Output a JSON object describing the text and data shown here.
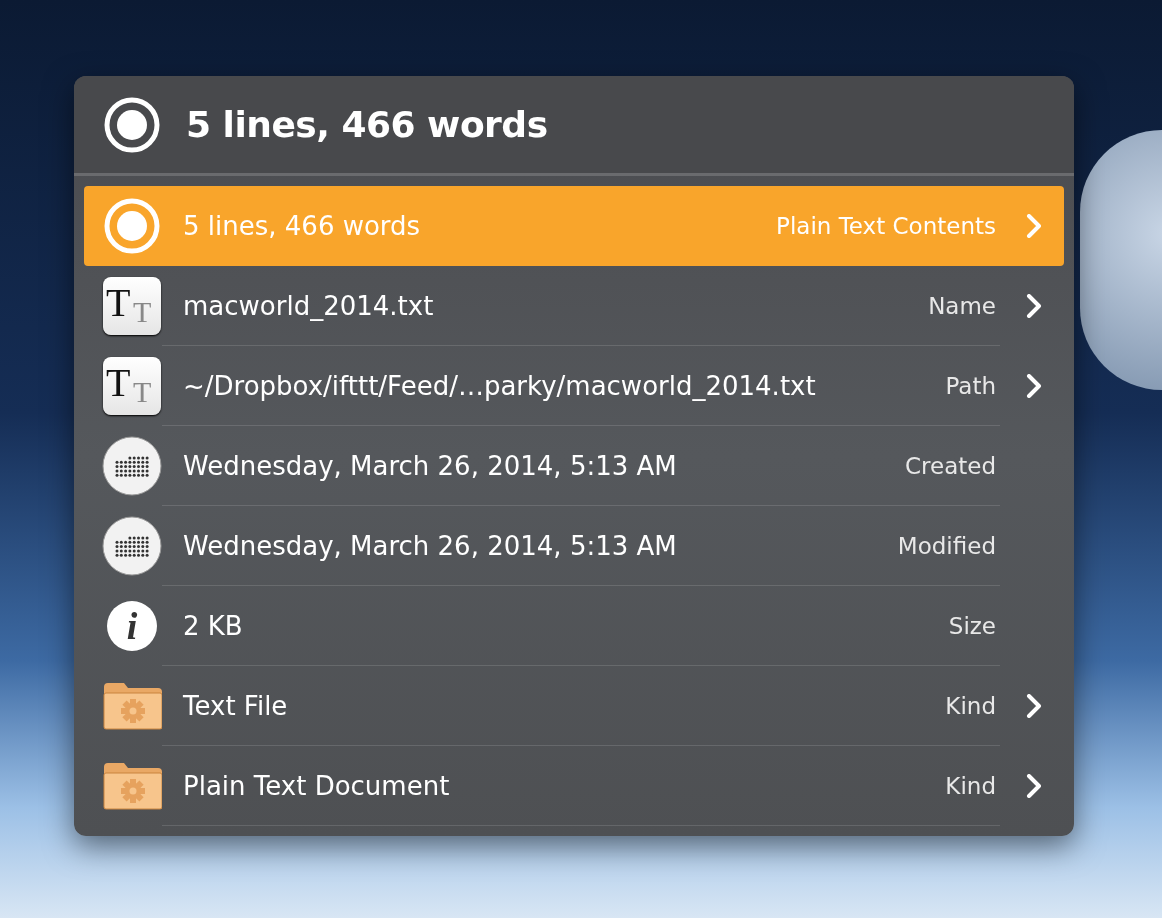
{
  "header": {
    "title": "5 lines, 466 words"
  },
  "rows": [
    {
      "kind": "radio",
      "text": "5 lines, 466 words",
      "label": "Plain Text Contents",
      "arrow": true,
      "selected": true
    },
    {
      "kind": "text-file",
      "icon_letters": [
        "T",
        "T"
      ],
      "text": "macworld_2014.txt",
      "label": "Name",
      "arrow": true,
      "selected": false
    },
    {
      "kind": "text-file",
      "icon_letters": [
        "T",
        "T"
      ],
      "text": "~/Dropbox/ifttt/Feed/…parky/macworld_2014.txt",
      "label": "Path",
      "arrow": true,
      "selected": false
    },
    {
      "kind": "calendar",
      "text": "Wednesday, March 26, 2014, 5:13 AM",
      "label": "Created",
      "arrow": false,
      "selected": false
    },
    {
      "kind": "calendar",
      "text": "Wednesday, March 26, 2014, 5:13 AM",
      "label": "Modified",
      "arrow": false,
      "selected": false
    },
    {
      "kind": "info",
      "icon_letters": [
        "i"
      ],
      "text": "2 KB",
      "label": "Size",
      "arrow": false,
      "selected": false
    },
    {
      "kind": "folder",
      "text": "Text File",
      "label": "Kind",
      "arrow": true,
      "selected": false
    },
    {
      "kind": "folder",
      "text": "Plain Text Document",
      "label": "Kind",
      "arrow": true,
      "selected": false
    }
  ]
}
